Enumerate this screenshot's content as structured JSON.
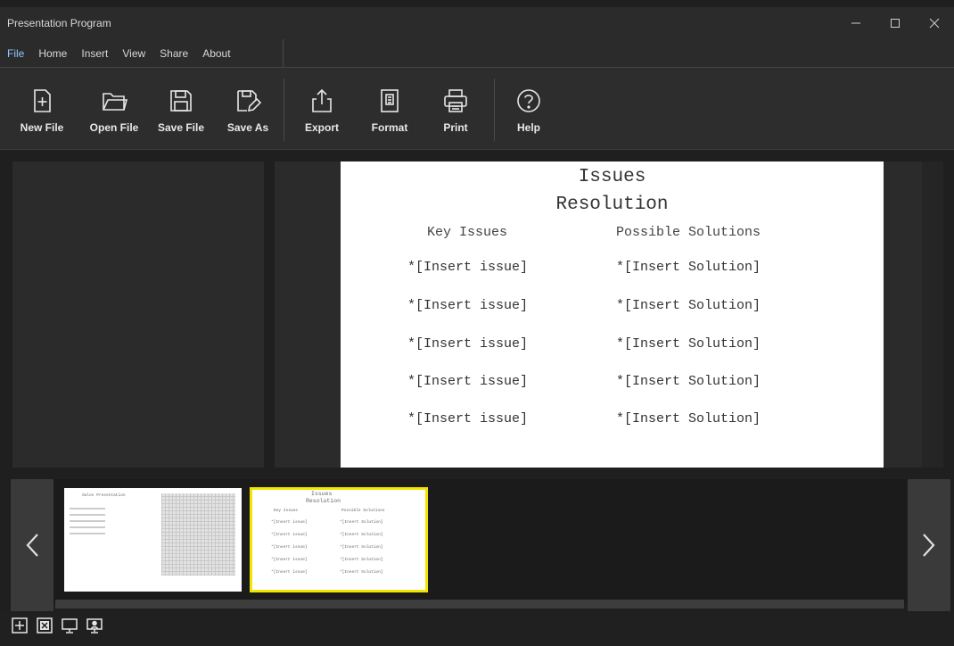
{
  "window": {
    "title": "Presentation Program"
  },
  "menu": {
    "items": [
      {
        "label": "File",
        "active": true
      },
      {
        "label": "Home",
        "active": false
      },
      {
        "label": "Insert",
        "active": false
      },
      {
        "label": "View",
        "active": false
      },
      {
        "label": "Share",
        "active": false
      },
      {
        "label": "About",
        "active": false
      }
    ]
  },
  "ribbon": {
    "new_file": "New File",
    "open_file": "Open File",
    "save_file": "Save File",
    "save_as": "Save As",
    "export": "Export",
    "format": "Format",
    "print": "Print",
    "help": "Help"
  },
  "slide": {
    "title_line1": "Issues",
    "title_line2": "Resolution",
    "col1_header": "Key Issues",
    "col2_header": "Possible Solutions",
    "rows": [
      {
        "issue": "*[Insert issue]",
        "solution": "*[Insert Solution]"
      },
      {
        "issue": "*[Insert issue]",
        "solution": "*[Insert Solution]"
      },
      {
        "issue": "*[Insert issue]",
        "solution": "*[Insert Solution]"
      },
      {
        "issue": "*[Insert issue]",
        "solution": "*[Insert Solution]"
      },
      {
        "issue": "*[Insert issue]",
        "solution": "*[Insert Solution]"
      }
    ]
  },
  "thumbnails": {
    "slide1_title": "Sales Presentation",
    "slide2_title_line1": "Issues",
    "slide2_title_line2": "Resolution",
    "slide2_col1": "Key Issues",
    "slide2_col2": "Possible Solutions",
    "slide2_issue": "*[Insert issue]",
    "slide2_solution": "*[Insert Solution]"
  },
  "colors": {
    "accent_tab": "#8ec6ff",
    "selected_thumb": "#f2e600"
  }
}
